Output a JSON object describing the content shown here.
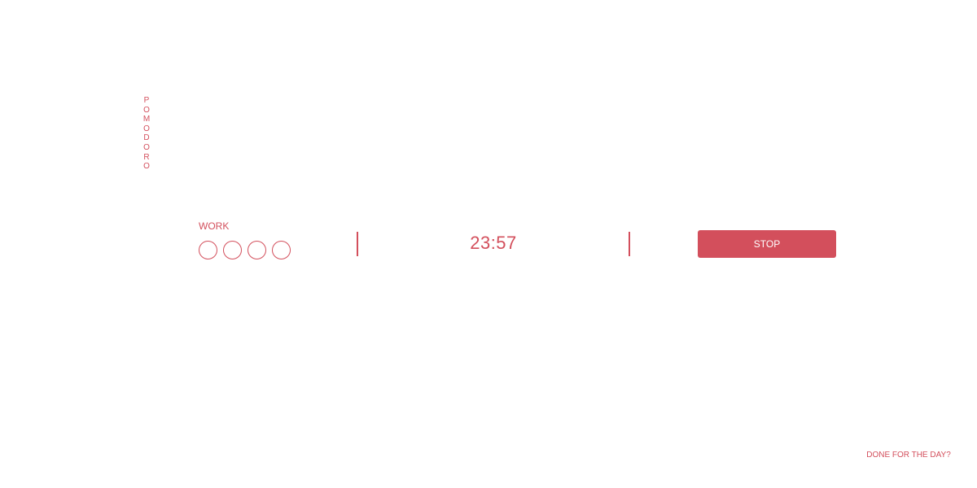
{
  "colors": {
    "accent": "#d34f5c",
    "background": "#ffffff",
    "button_text": "#ffffff"
  },
  "brand": {
    "letters": [
      "P",
      "O",
      "M",
      "O",
      "D",
      "O",
      "R",
      "O"
    ]
  },
  "session": {
    "mode_label": "WORK",
    "completed_count": 0,
    "circles_total": 4
  },
  "timer": {
    "display": "23:57"
  },
  "controls": {
    "stop_label": "STOP"
  },
  "footer": {
    "done_label": "DONE FOR THE DAY?"
  }
}
